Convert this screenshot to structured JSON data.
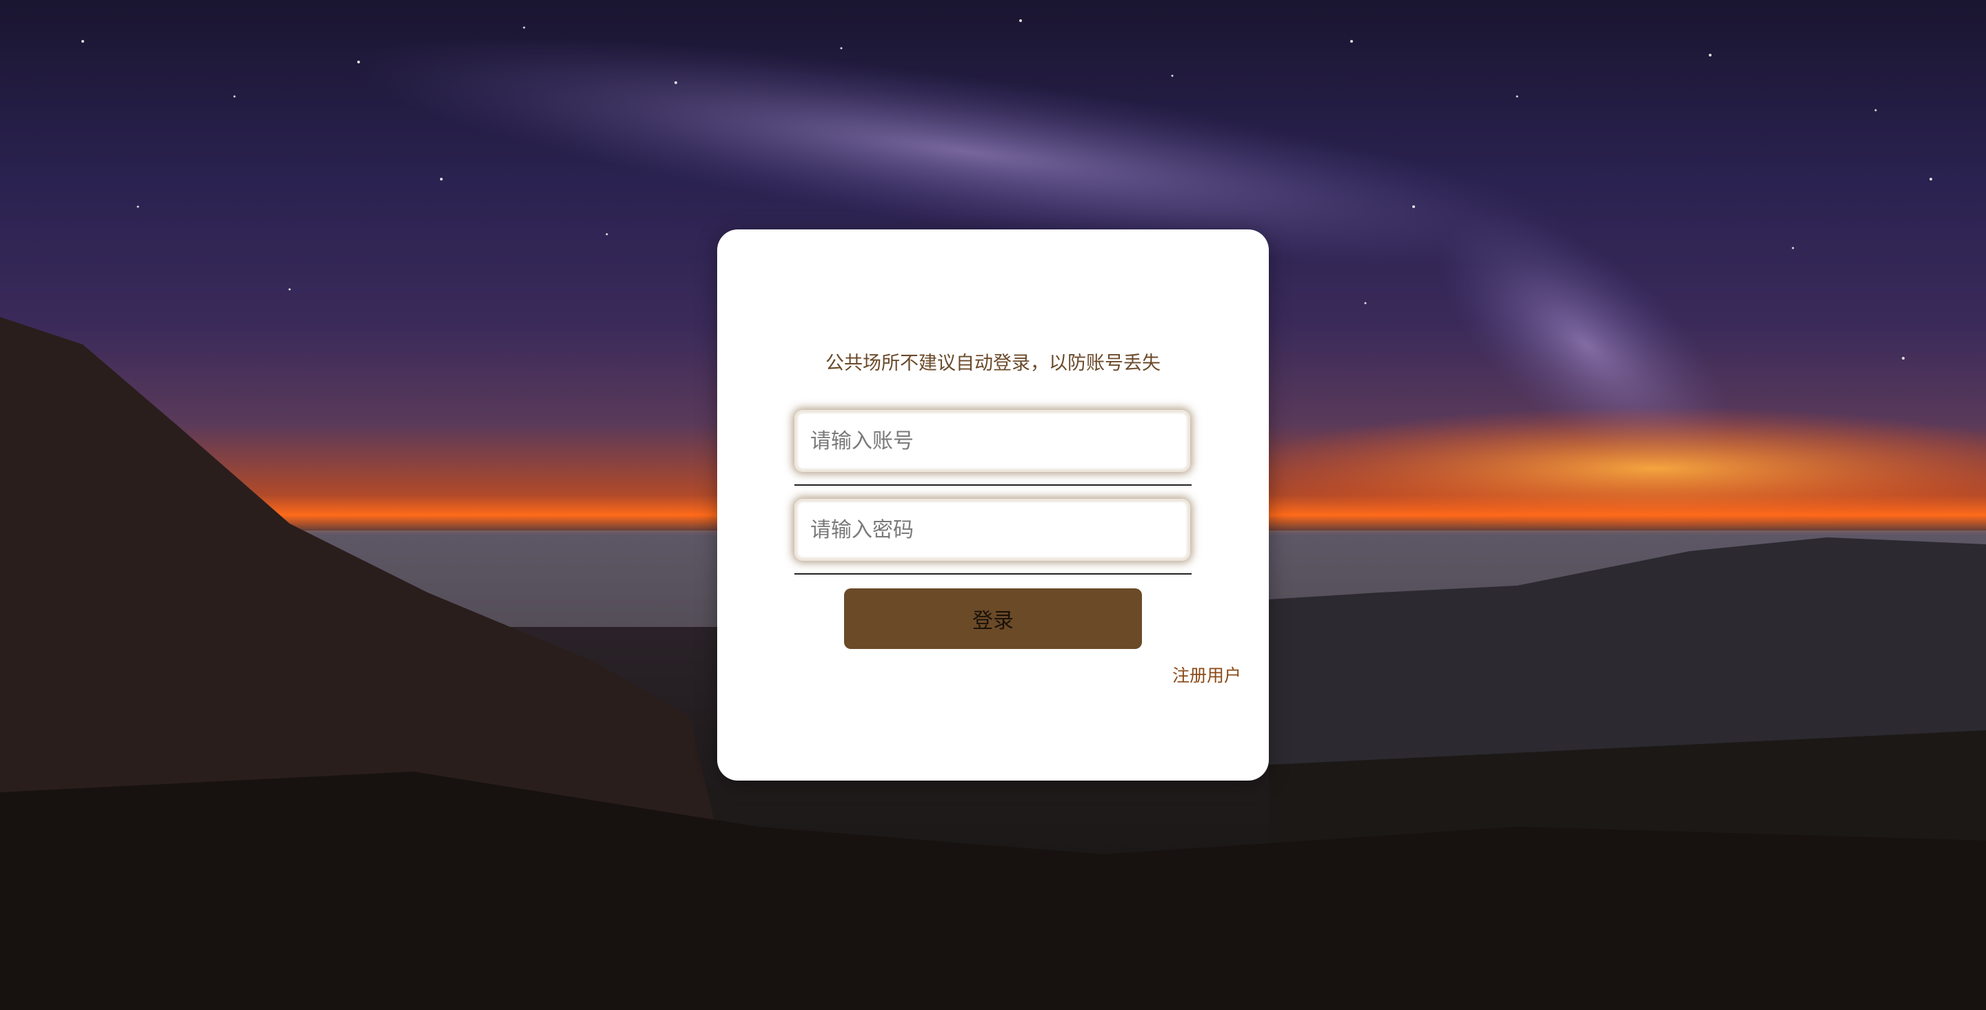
{
  "login": {
    "notice": "公共场所不建议自动登录，以防账号丢失",
    "account_placeholder": "请输入账号",
    "password_placeholder": "请输入密码",
    "login_label": "登录",
    "register_label": "注册用户"
  },
  "colors": {
    "accent": "#6b4a28",
    "notice_text": "#6b4a2a",
    "link": "#8a4a18"
  }
}
